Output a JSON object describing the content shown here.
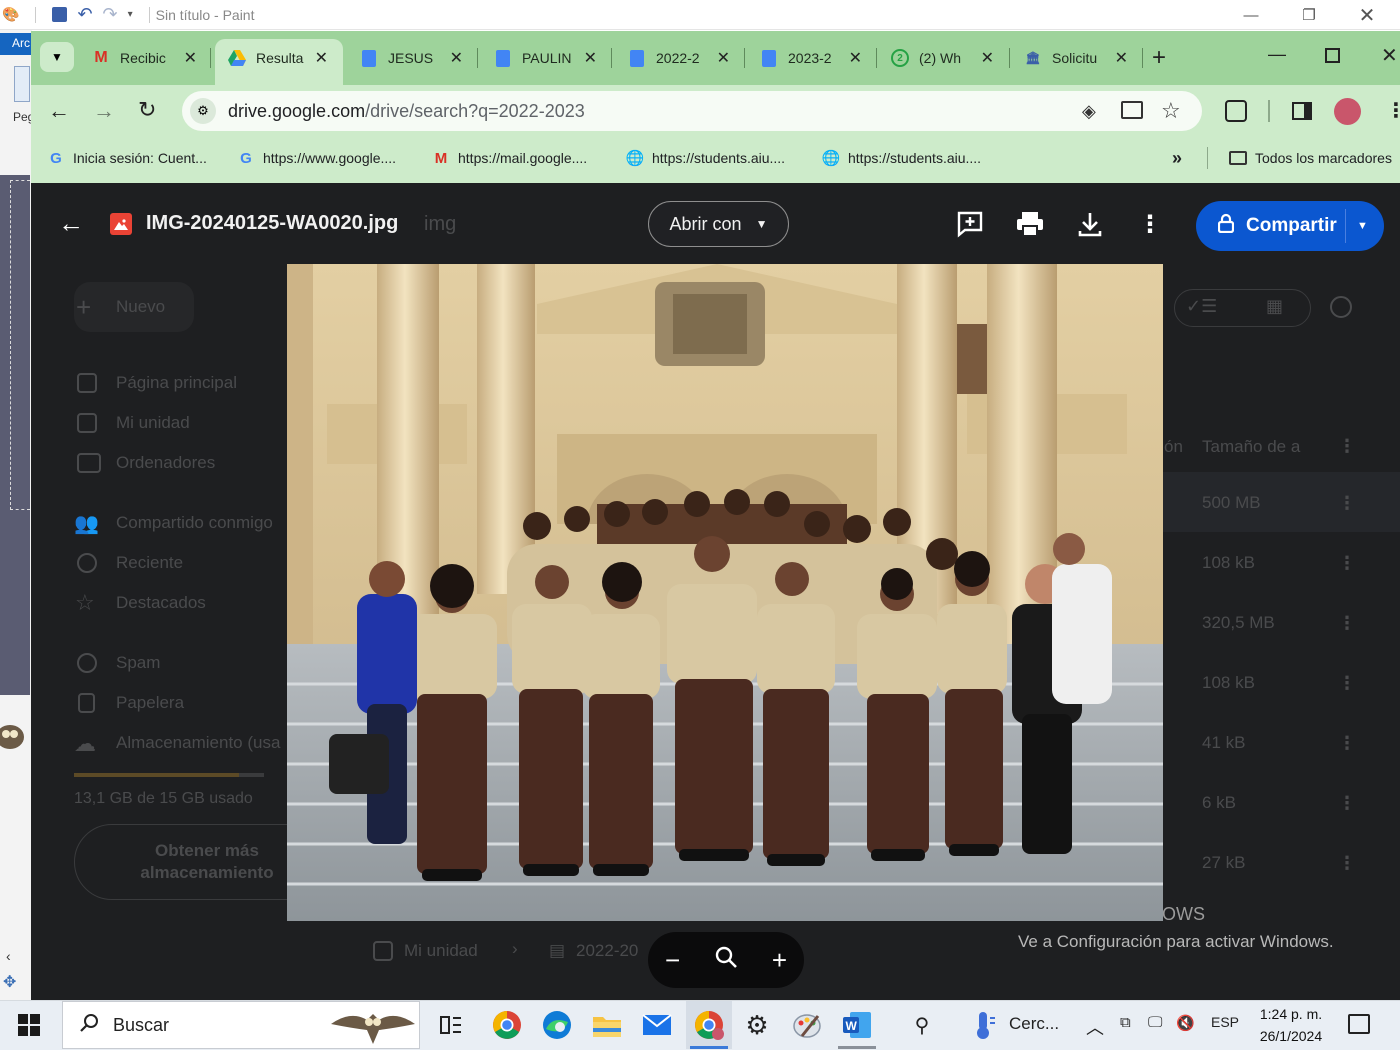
{
  "paint": {
    "title": "Sin título - Paint",
    "tab_label": "Arc",
    "left_label": "Peg"
  },
  "browser": {
    "tabs": [
      {
        "label": "Recibic",
        "favicon": "gmail-icon"
      },
      {
        "label": "Resulta",
        "favicon": "drive-icon",
        "active": true
      },
      {
        "label": "JESUS",
        "favicon": "docs-icon"
      },
      {
        "label": "PAULIN",
        "favicon": "docs-icon"
      },
      {
        "label": "2022-2",
        "favicon": "docs-icon"
      },
      {
        "label": "2023-2",
        "favicon": "docs-icon"
      },
      {
        "label": "(2) Wh",
        "favicon": "whatsapp-icon"
      },
      {
        "label": "Solicitu",
        "favicon": "institution-icon"
      }
    ],
    "url_host": "drive.google.com",
    "url_path": "/drive/search?q=2022-2023",
    "bookmarks": [
      {
        "label": "Inicia sesión: Cuent...",
        "favicon": "G"
      },
      {
        "label": "https://www.google....",
        "favicon": "G"
      },
      {
        "label": "https://mail.google....",
        "favicon": "M"
      },
      {
        "label": "https://students.aiu....",
        "favicon": "globe"
      },
      {
        "label": "https://students.aiu....",
        "favicon": "globe"
      }
    ],
    "all_bookmarks": "Todos los marcadores",
    "more_bookmarks": "»"
  },
  "drive": {
    "new_button": "Nuevo",
    "nav": [
      "Página principal",
      "Mi unidad",
      "Ordenadores",
      "Compartido conmigo",
      "Reciente",
      "Destacados",
      "Spam",
      "Papelera",
      "Almacenamiento (usa"
    ],
    "storage_used": "13,1 GB de 15 GB usado",
    "storage_fraction": 0.87,
    "get_more": "Obtener más almacenamiento",
    "column_partial": "ón",
    "column_size": "Tamaño de a",
    "sizes": [
      "500 MB",
      "108 kB",
      "320,5 MB",
      "108 kB",
      "41 kB",
      "6 kB",
      "27 kB"
    ],
    "search_label_partial": "img",
    "breadcrumb": [
      "Mi unidad",
      "2022-20"
    ]
  },
  "viewer": {
    "filename": "IMG-20240125-WA0020.jpg",
    "open_with": "Abrir con",
    "share": "Compartir",
    "zoom_out": "−",
    "zoom_in": "+"
  },
  "windows": {
    "activate_partial": "OWS",
    "activate_msg": "Ve a Configuración para activar Windows.",
    "search": "Buscar",
    "weather": "Cerc...",
    "lang": "ESP",
    "time": "1:24 p. m.",
    "date": "26/1/2024"
  }
}
